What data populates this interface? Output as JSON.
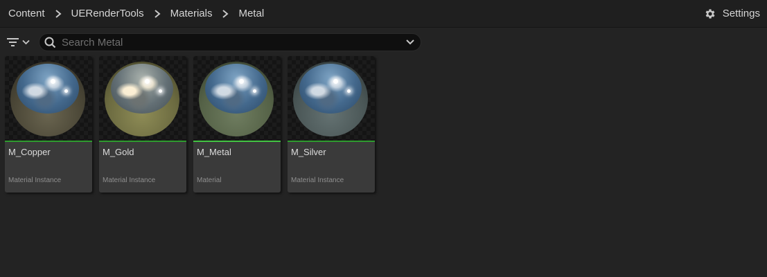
{
  "breadcrumb": {
    "items": [
      "Content",
      "UERenderTools",
      "Materials",
      "Metal"
    ]
  },
  "settings": {
    "label": "Settings",
    "icon": "gear-icon"
  },
  "toolbar": {
    "filter_icon": "filter-icon",
    "search_placeholder": "Search Metal",
    "search_value": ""
  },
  "colors": {
    "background": "#232323",
    "tile_background": "#3a3a3a",
    "asset_type_bar": "#2e9b2e",
    "copper_base": "#5a5540",
    "gold_base": "#7a7a4a",
    "metal_base": "#5b6a50",
    "silver_base": "#4d5a5a"
  },
  "assets": [
    {
      "name": "M_Copper",
      "type": "Material Instance"
    },
    {
      "name": "M_Gold",
      "type": "Material Instance"
    },
    {
      "name": "M_Metal",
      "type": "Material"
    },
    {
      "name": "M_Silver",
      "type": "Material Instance"
    }
  ]
}
